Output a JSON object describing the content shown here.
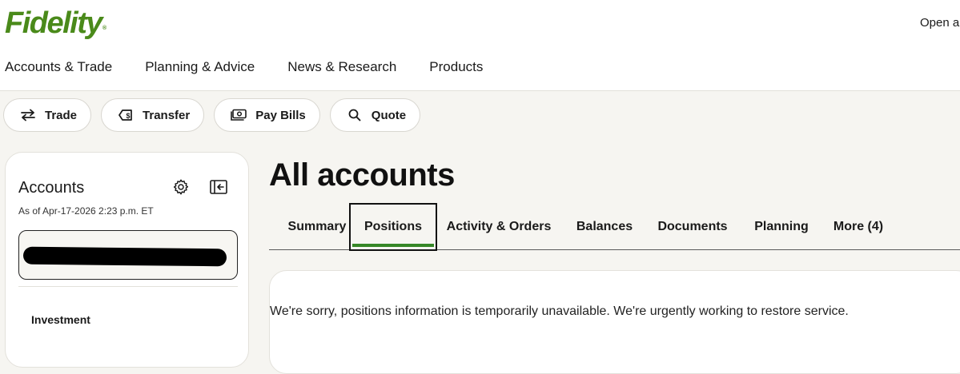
{
  "header": {
    "logo_text": "Fidelity",
    "logo_mark": "®",
    "brand_color": "#4a8a1a",
    "open_link": "Open an",
    "nav": [
      "Accounts & Trade",
      "Planning & Advice",
      "News & Research",
      "Products"
    ]
  },
  "actions": [
    {
      "label": "Trade",
      "icon": "trade-arrows-icon"
    },
    {
      "label": "Transfer",
      "icon": "transfer-icon"
    },
    {
      "label": "Pay Bills",
      "icon": "pay-bills-icon"
    },
    {
      "label": "Quote",
      "icon": "search-icon"
    }
  ],
  "sidebar": {
    "title": "Accounts",
    "as_of": "As of Apr-17-2026 2:23 p.m. ET",
    "section": "Investment"
  },
  "main": {
    "title": "All accounts",
    "tabs": [
      "Summary",
      "Positions",
      "Activity & Orders",
      "Balances",
      "Documents",
      "Planning",
      "More (4)"
    ],
    "active_tab": "Positions",
    "message": "We're sorry, positions information is temporarily unavailable. We're urgently working to restore service."
  },
  "colors": {
    "accent_green": "#368727",
    "page_background": "#f6f5f1"
  }
}
